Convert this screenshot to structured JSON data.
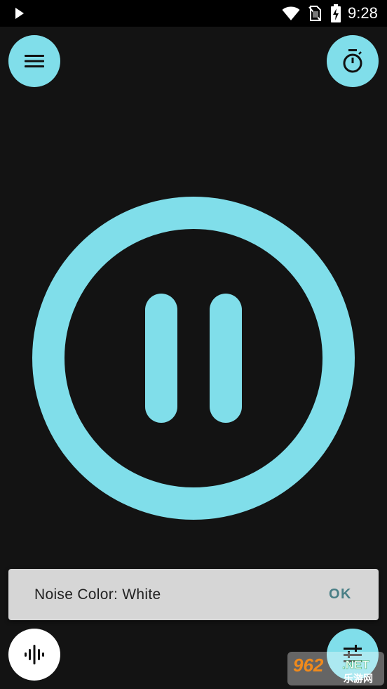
{
  "status_bar": {
    "time": "9:28",
    "icons": [
      "play-indicator-icon",
      "wifi-icon",
      "no-sim-icon",
      "battery-charging-icon"
    ]
  },
  "top_bar": {
    "menu_icon": "hamburger-menu-icon",
    "timer_icon": "stopwatch-icon"
  },
  "player": {
    "state": "playing",
    "control_icon": "pause-icon"
  },
  "snackbar": {
    "message": "Noise Color: White",
    "action_label": "OK"
  },
  "bottom_bar": {
    "noise_icon": "sound-wave-icon",
    "equalizer_icon": "equalizer-icon"
  },
  "watermark": {
    "brand_number": "962",
    "brand_suffix": ".NET",
    "brand_cn": "乐游网"
  },
  "colors": {
    "accent": "#80deea",
    "background": "#131313",
    "status_bar": "#000000",
    "snackbar_bg": "#d6d6d6",
    "snackbar_action": "#4a7f86"
  }
}
